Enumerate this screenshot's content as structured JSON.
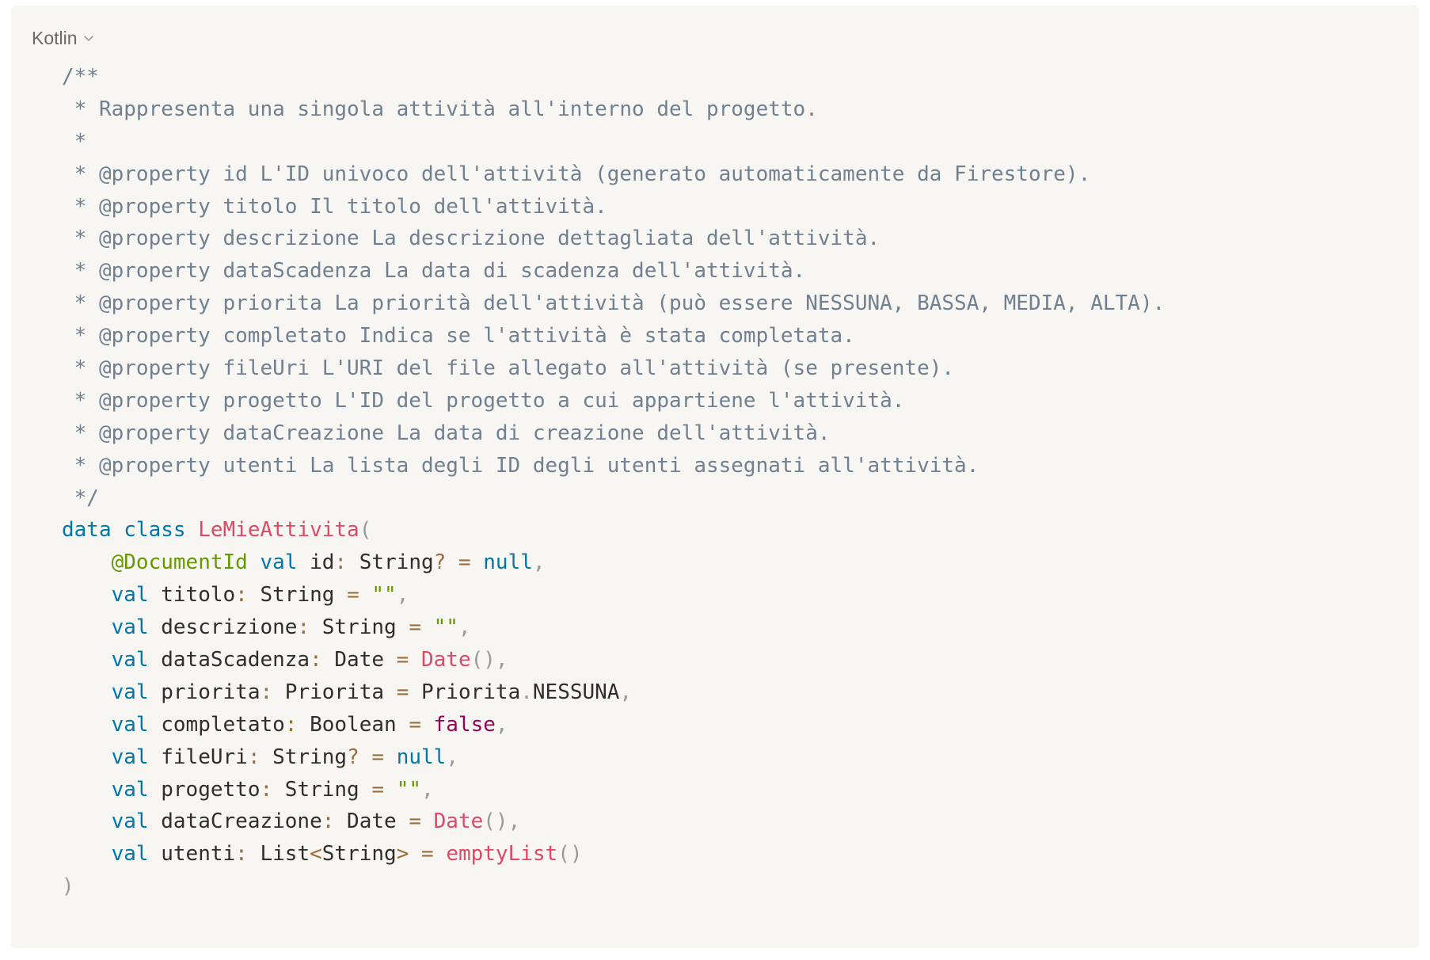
{
  "language_selector": {
    "label": "Kotlin",
    "icon": "chevron-down-icon"
  },
  "colors": {
    "background": "#f7f6f3",
    "comment": "#708090",
    "keyword": "#0077aa",
    "function": "#dd4a68",
    "punctuation": "#999999",
    "operator": "#9a6e3a",
    "annotation": "#669900",
    "string": "#669900",
    "boolean": "#990055",
    "plain": "#2f2e2b"
  },
  "code_lines": [
    [
      {
        "t": "c-comment",
        "v": "/**"
      }
    ],
    [
      {
        "t": "c-comment",
        "v": " * Rappresenta una singola attività all'interno del progetto."
      }
    ],
    [
      {
        "t": "c-comment",
        "v": " *"
      }
    ],
    [
      {
        "t": "c-comment",
        "v": " * @property id L'ID univoco dell'attività (generato automaticamente da Firestore)."
      }
    ],
    [
      {
        "t": "c-comment",
        "v": " * @property titolo Il titolo dell'attività."
      }
    ],
    [
      {
        "t": "c-comment",
        "v": " * @property descrizione La descrizione dettagliata dell'attività."
      }
    ],
    [
      {
        "t": "c-comment",
        "v": " * @property dataScadenza La data di scadenza dell'attività."
      }
    ],
    [
      {
        "t": "c-comment",
        "v": " * @property priorita La priorità dell'attività (può essere NESSUNA, BASSA, MEDIA, ALTA)."
      }
    ],
    [
      {
        "t": "c-comment",
        "v": " * @property completato Indica se l'attività è stata completata."
      }
    ],
    [
      {
        "t": "c-comment",
        "v": " * @property fileUri L'URI del file allegato all'attività (se presente)."
      }
    ],
    [
      {
        "t": "c-comment",
        "v": " * @property progetto L'ID del progetto a cui appartiene l'attività."
      }
    ],
    [
      {
        "t": "c-comment",
        "v": " * @property dataCreazione La data di creazione dell'attività."
      }
    ],
    [
      {
        "t": "c-comment",
        "v": " * @property utenti La lista degli ID degli utenti assegnati all'attività."
      }
    ],
    [
      {
        "t": "c-comment",
        "v": " */"
      }
    ],
    [
      {
        "t": "c-keyword",
        "v": "data"
      },
      {
        "t": "c-plain",
        "v": " "
      },
      {
        "t": "c-keyword",
        "v": "class"
      },
      {
        "t": "c-plain",
        "v": " "
      },
      {
        "t": "c-fn",
        "v": "LeMieAttivita"
      },
      {
        "t": "c-punct",
        "v": "("
      }
    ],
    [
      {
        "t": "c-plain",
        "v": "    "
      },
      {
        "t": "c-anno",
        "v": "@DocumentId"
      },
      {
        "t": "c-plain",
        "v": " "
      },
      {
        "t": "c-keyword",
        "v": "val"
      },
      {
        "t": "c-plain",
        "v": " id"
      },
      {
        "t": "c-op",
        "v": ":"
      },
      {
        "t": "c-plain",
        "v": " String"
      },
      {
        "t": "c-op",
        "v": "?"
      },
      {
        "t": "c-plain",
        "v": " "
      },
      {
        "t": "c-op",
        "v": "="
      },
      {
        "t": "c-plain",
        "v": " "
      },
      {
        "t": "c-keyword",
        "v": "null"
      },
      {
        "t": "c-punct",
        "v": ","
      }
    ],
    [
      {
        "t": "c-plain",
        "v": "    "
      },
      {
        "t": "c-keyword",
        "v": "val"
      },
      {
        "t": "c-plain",
        "v": " titolo"
      },
      {
        "t": "c-op",
        "v": ":"
      },
      {
        "t": "c-plain",
        "v": " String "
      },
      {
        "t": "c-op",
        "v": "="
      },
      {
        "t": "c-plain",
        "v": " "
      },
      {
        "t": "c-string",
        "v": "\"\""
      },
      {
        "t": "c-punct",
        "v": ","
      }
    ],
    [
      {
        "t": "c-plain",
        "v": "    "
      },
      {
        "t": "c-keyword",
        "v": "val"
      },
      {
        "t": "c-plain",
        "v": " descrizione"
      },
      {
        "t": "c-op",
        "v": ":"
      },
      {
        "t": "c-plain",
        "v": " String "
      },
      {
        "t": "c-op",
        "v": "="
      },
      {
        "t": "c-plain",
        "v": " "
      },
      {
        "t": "c-string",
        "v": "\"\""
      },
      {
        "t": "c-punct",
        "v": ","
      }
    ],
    [
      {
        "t": "c-plain",
        "v": "    "
      },
      {
        "t": "c-keyword",
        "v": "val"
      },
      {
        "t": "c-plain",
        "v": " dataScadenza"
      },
      {
        "t": "c-op",
        "v": ":"
      },
      {
        "t": "c-plain",
        "v": " Date "
      },
      {
        "t": "c-op",
        "v": "="
      },
      {
        "t": "c-plain",
        "v": " "
      },
      {
        "t": "c-fn",
        "v": "Date"
      },
      {
        "t": "c-punct",
        "v": "(),"
      }
    ],
    [
      {
        "t": "c-plain",
        "v": "    "
      },
      {
        "t": "c-keyword",
        "v": "val"
      },
      {
        "t": "c-plain",
        "v": " priorita"
      },
      {
        "t": "c-op",
        "v": ":"
      },
      {
        "t": "c-plain",
        "v": " Priorita "
      },
      {
        "t": "c-op",
        "v": "="
      },
      {
        "t": "c-plain",
        "v": " Priorita"
      },
      {
        "t": "c-punct",
        "v": "."
      },
      {
        "t": "c-plain",
        "v": "NESSUNA"
      },
      {
        "t": "c-punct",
        "v": ","
      }
    ],
    [
      {
        "t": "c-plain",
        "v": "    "
      },
      {
        "t": "c-keyword",
        "v": "val"
      },
      {
        "t": "c-plain",
        "v": " completato"
      },
      {
        "t": "c-op",
        "v": ":"
      },
      {
        "t": "c-plain",
        "v": " Boolean "
      },
      {
        "t": "c-op",
        "v": "="
      },
      {
        "t": "c-plain",
        "v": " "
      },
      {
        "t": "c-bool",
        "v": "false"
      },
      {
        "t": "c-punct",
        "v": ","
      }
    ],
    [
      {
        "t": "c-plain",
        "v": "    "
      },
      {
        "t": "c-keyword",
        "v": "val"
      },
      {
        "t": "c-plain",
        "v": " fileUri"
      },
      {
        "t": "c-op",
        "v": ":"
      },
      {
        "t": "c-plain",
        "v": " String"
      },
      {
        "t": "c-op",
        "v": "?"
      },
      {
        "t": "c-plain",
        "v": " "
      },
      {
        "t": "c-op",
        "v": "="
      },
      {
        "t": "c-plain",
        "v": " "
      },
      {
        "t": "c-keyword",
        "v": "null"
      },
      {
        "t": "c-punct",
        "v": ","
      }
    ],
    [
      {
        "t": "c-plain",
        "v": "    "
      },
      {
        "t": "c-keyword",
        "v": "val"
      },
      {
        "t": "c-plain",
        "v": " progetto"
      },
      {
        "t": "c-op",
        "v": ":"
      },
      {
        "t": "c-plain",
        "v": " String "
      },
      {
        "t": "c-op",
        "v": "="
      },
      {
        "t": "c-plain",
        "v": " "
      },
      {
        "t": "c-string",
        "v": "\"\""
      },
      {
        "t": "c-punct",
        "v": ","
      }
    ],
    [
      {
        "t": "c-plain",
        "v": "    "
      },
      {
        "t": "c-keyword",
        "v": "val"
      },
      {
        "t": "c-plain",
        "v": " dataCreazione"
      },
      {
        "t": "c-op",
        "v": ":"
      },
      {
        "t": "c-plain",
        "v": " Date "
      },
      {
        "t": "c-op",
        "v": "="
      },
      {
        "t": "c-plain",
        "v": " "
      },
      {
        "t": "c-fn",
        "v": "Date"
      },
      {
        "t": "c-punct",
        "v": "(),"
      }
    ],
    [
      {
        "t": "c-plain",
        "v": "    "
      },
      {
        "t": "c-keyword",
        "v": "val"
      },
      {
        "t": "c-plain",
        "v": " utenti"
      },
      {
        "t": "c-op",
        "v": ":"
      },
      {
        "t": "c-plain",
        "v": " List"
      },
      {
        "t": "c-op",
        "v": "<"
      },
      {
        "t": "c-plain",
        "v": "String"
      },
      {
        "t": "c-op",
        "v": ">"
      },
      {
        "t": "c-plain",
        "v": " "
      },
      {
        "t": "c-op",
        "v": "="
      },
      {
        "t": "c-plain",
        "v": " "
      },
      {
        "t": "c-fn",
        "v": "emptyList"
      },
      {
        "t": "c-punct",
        "v": "()"
      }
    ],
    [
      {
        "t": "c-punct",
        "v": ")"
      }
    ]
  ]
}
